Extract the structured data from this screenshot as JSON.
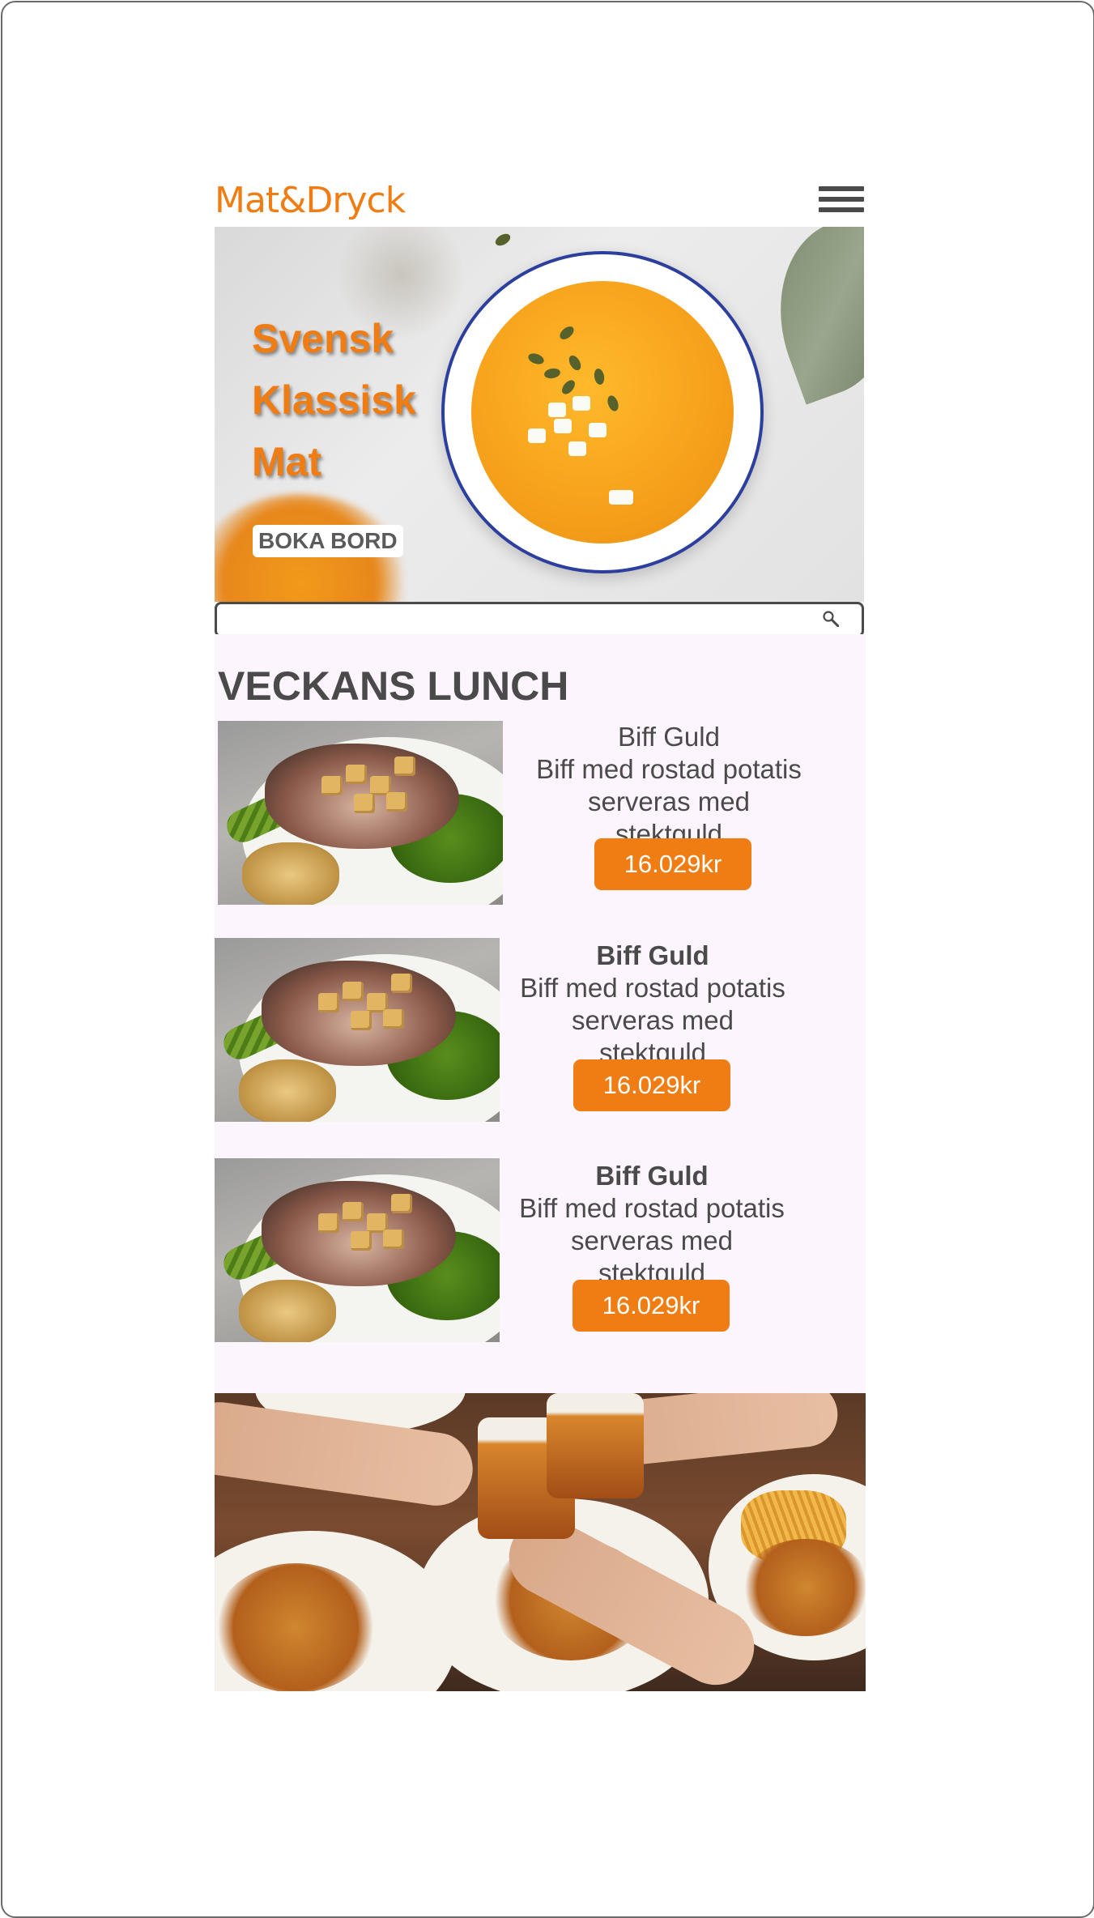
{
  "header": {
    "logo": "Mat&Dryck",
    "menu_icon": "hamburger-menu-icon"
  },
  "hero": {
    "title_lines": [
      "Svensk",
      "Klassisk",
      "Mat"
    ],
    "book_button": "BOKA BORD"
  },
  "search": {
    "placeholder": "",
    "value": "",
    "icon": "search-icon"
  },
  "lunch": {
    "title": "VECKANS LUNCH",
    "dishes": [
      {
        "name": "Biff Guld",
        "line1": "Biff med rostad potatis",
        "line2": "serveras med stektguld",
        "price": "16.029kr",
        "bold": false
      },
      {
        "name": "Biff Guld",
        "line1": "Biff med rostad potatis",
        "line2": "serveras med stektguld",
        "price": "16.029kr",
        "bold": true
      },
      {
        "name": "Biff Guld",
        "line1": "Biff med rostad potatis",
        "line2": "serveras med stektguld",
        "price": "16.029kr",
        "bold": true
      }
    ]
  },
  "colors": {
    "accent": "#ef7d14",
    "text": "#4a4a4a",
    "section_bg": "#fdf5fd"
  }
}
